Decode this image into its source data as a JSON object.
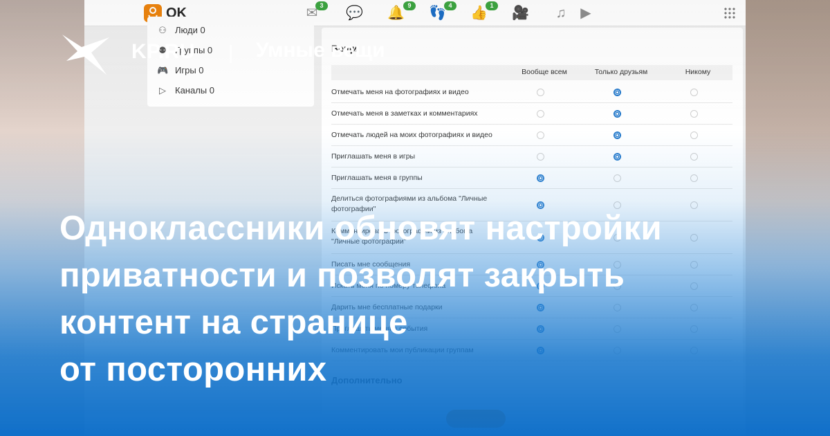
{
  "brand": {
    "site": "KP.RU",
    "separator": "|",
    "section": "Умные вещи"
  },
  "headline": {
    "line1": "Одноклассники обновят настройки",
    "line2": "приватности и позволят закрыть",
    "line3": "контент на странице",
    "line4": "от посторонних"
  },
  "ok_app": {
    "logo_text": "OK",
    "logo_color": "#ee8208",
    "nav": [
      {
        "icon": "messages-icon",
        "badge": "3"
      },
      {
        "icon": "discussions-icon",
        "badge": ""
      },
      {
        "icon": "notifications-icon",
        "badge": "9"
      },
      {
        "icon": "guests-icon",
        "badge": "4"
      },
      {
        "icon": "events-icon",
        "badge": "1"
      },
      {
        "icon": "video-icon",
        "badge": ""
      },
      {
        "icon": "music-icon",
        "badge": ""
      },
      {
        "icon": "play-icon",
        "badge": ""
      }
    ],
    "sidebar": [
      {
        "label": "Люди 0",
        "icon": "people-icon"
      },
      {
        "label": "Группы 0",
        "icon": "groups-icon"
      },
      {
        "label": "Игры 0",
        "icon": "games-icon"
      },
      {
        "label": "Каналы 0",
        "icon": "channels-icon"
      }
    ],
    "section_title": "Вещи",
    "columns": [
      "Вообще всем",
      "Только друзьям",
      "Никому"
    ],
    "rows": [
      {
        "label": "Отмечать меня на фотографиях и видео",
        "selected": 1
      },
      {
        "label": "Отмечать меня в заметках и комментариях",
        "selected": 1
      },
      {
        "label": "Отмечать людей на моих фотографиях и видео",
        "selected": 1
      },
      {
        "label": "Приглашать меня в игры",
        "selected": 1
      },
      {
        "label": "Приглашать меня в группы",
        "selected": 0
      },
      {
        "label": "Делиться фотографиями из альбома \"Личные фотографии\"",
        "selected": 0
      },
      {
        "label": "Комментировать фотографии из альбома \"Личные фотографии\"",
        "selected": 0
      },
      {
        "label": "Писать мне сообщения",
        "selected": 0
      },
      {
        "label": "Искать меня по номеру телефона",
        "selected": 0
      },
      {
        "label": "Дарить мне бесплатные подарки",
        "selected": 0
      },
      {
        "label": "Приглашать меня в события",
        "selected": 0
      },
      {
        "label": "Комментировать мои публикации группам",
        "selected": 0
      }
    ],
    "extra_title": "Дополнительно",
    "accent": "#1a73c9",
    "badge_color": "#38a33c"
  }
}
